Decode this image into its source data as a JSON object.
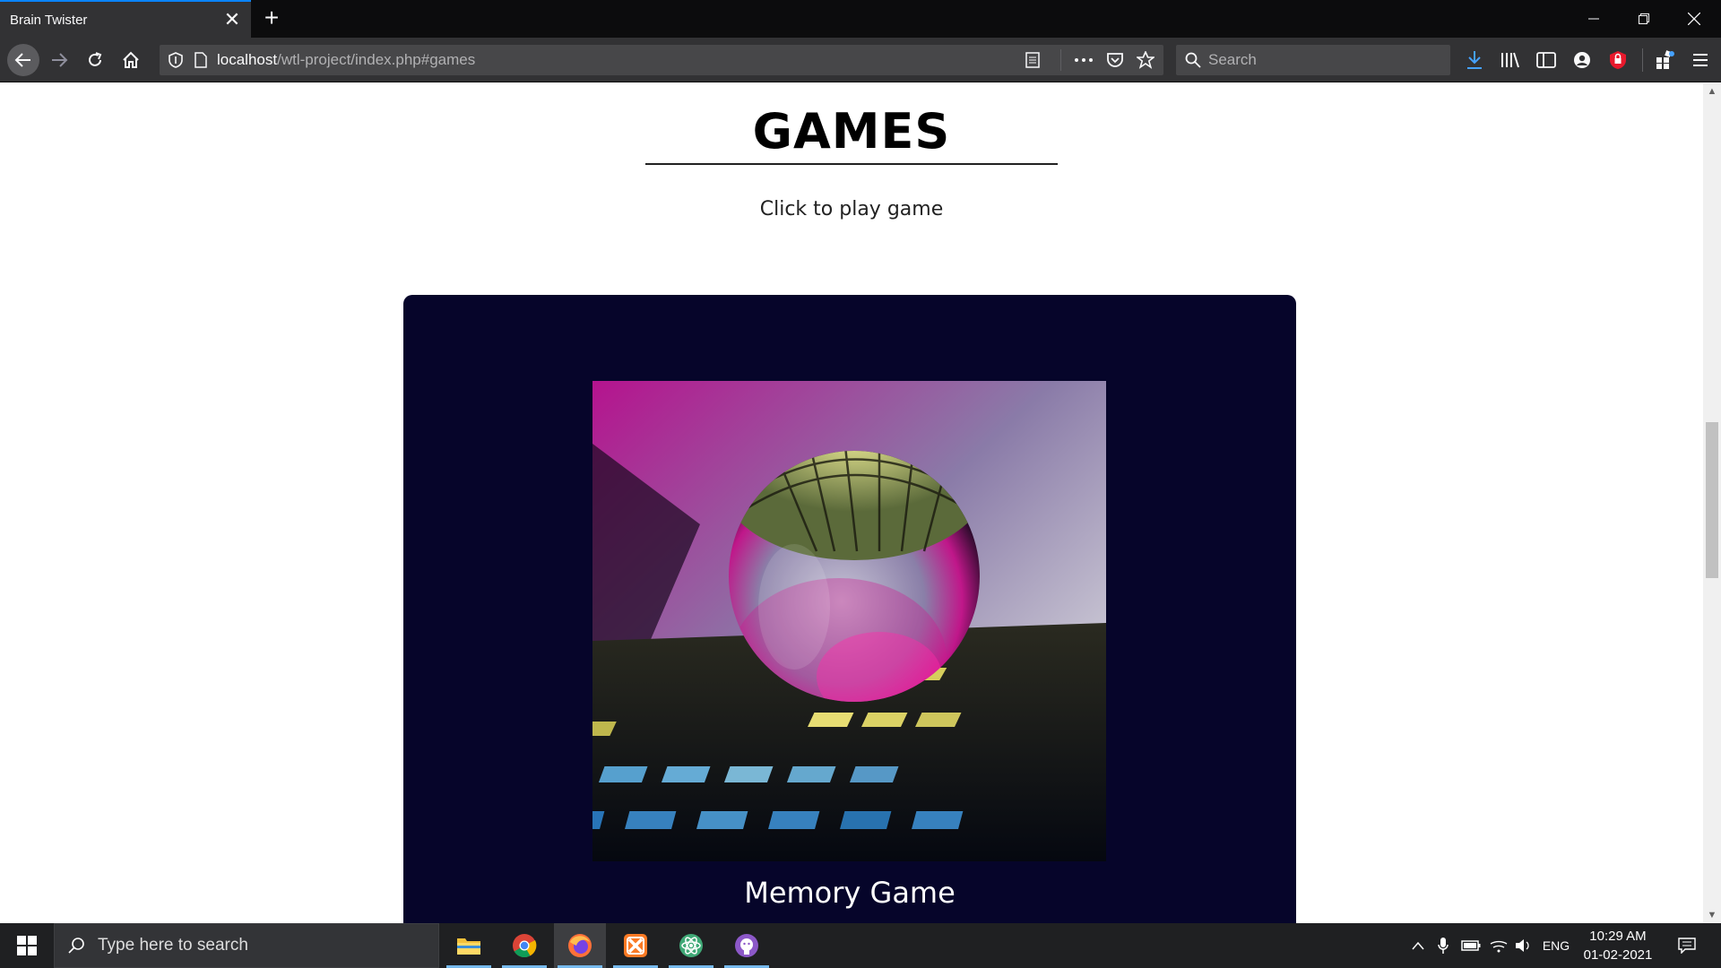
{
  "browser": {
    "tab_title": "Brain Twister",
    "url_host": "localhost",
    "url_path": "/wtl-project/index.php#games",
    "search_placeholder": "Search"
  },
  "page": {
    "title": "GAMES",
    "subtitle": "Click to play game",
    "games": [
      {
        "name": "Memory Game",
        "image": "crystal-ball-on-grid"
      }
    ]
  },
  "taskbar": {
    "search_placeholder": "Type here to search",
    "language": "ENG",
    "time": "10:29 AM",
    "date": "01-02-2021",
    "pinned_apps": [
      "file-explorer",
      "chrome",
      "firefox",
      "xampp",
      "atom",
      "github-desktop"
    ]
  },
  "colors": {
    "card_background": "#06052a",
    "tab_accent": "#0a84ff"
  }
}
